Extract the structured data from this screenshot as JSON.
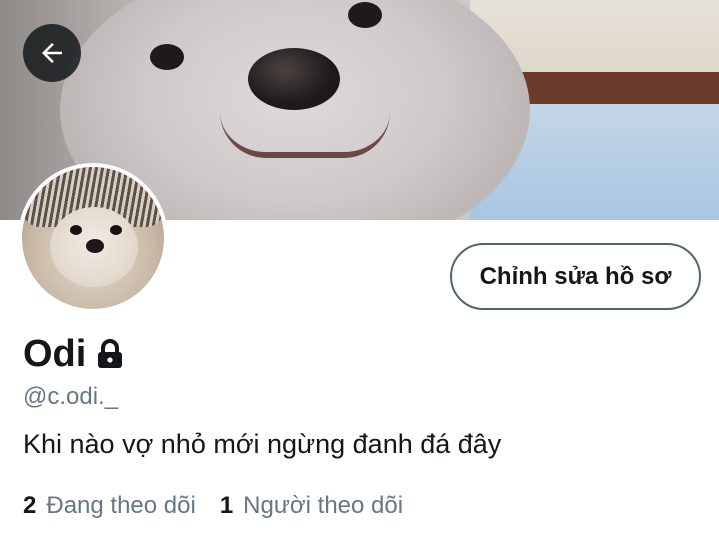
{
  "profile": {
    "display_name": "Odi",
    "handle": "@c.odi._",
    "bio": "Khi nào vợ nhỏ mới ngừng đanh đá đây",
    "following_count": "2",
    "following_label": "Đang theo dõi",
    "followers_count": "1",
    "followers_label": "Người theo dõi"
  },
  "actions": {
    "edit_profile_label": "Chỉnh sửa hồ sơ"
  },
  "icons": {
    "back": "arrow-left-icon",
    "protected": "lock-icon"
  },
  "colors": {
    "text_primary": "#14171a",
    "text_secondary": "#657786",
    "button_border": "#536471"
  }
}
